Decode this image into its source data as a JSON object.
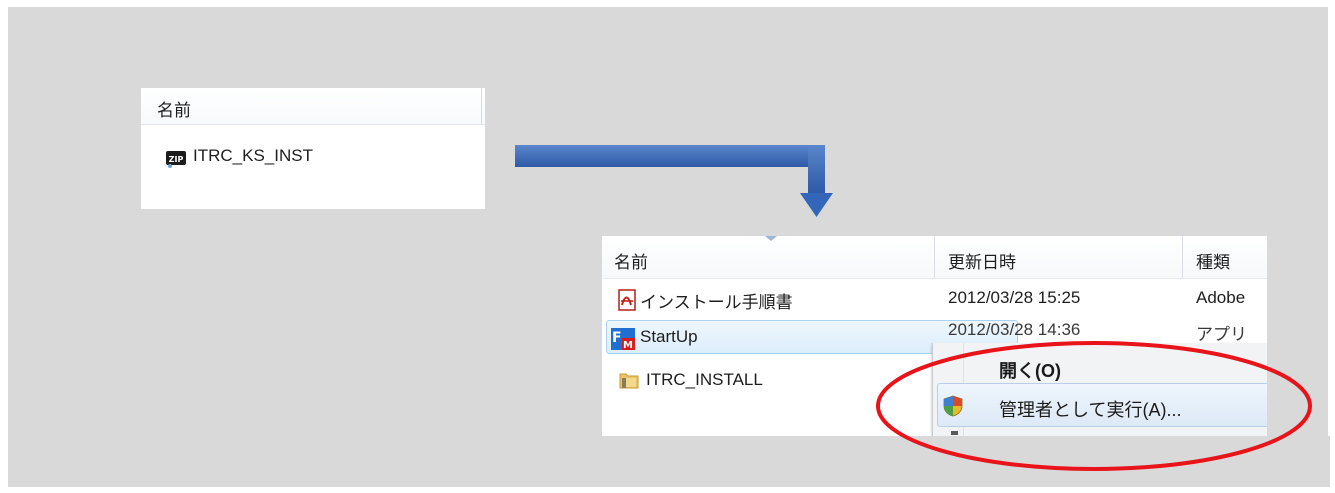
{
  "zip_panel": {
    "column_name": "名前",
    "item": {
      "name": "ITRC_KS_INST",
      "icon": "zip-file-icon"
    }
  },
  "files_panel": {
    "columns": [
      "名前",
      "更新日時",
      "種類"
    ],
    "rows": [
      {
        "name": "インストール手順書",
        "date": "2012/03/28 15:25",
        "type": "Adobe",
        "icon": "pdf-icon"
      },
      {
        "name": "StartUp",
        "date": "2012/03/28 14:36",
        "type": "アプリ",
        "icon": "app-icon"
      },
      {
        "name": "ITRC_INSTALL",
        "date": "",
        "type": "",
        "icon": "folder-icon"
      }
    ]
  },
  "context_menu": {
    "open_label": "開く(O)",
    "run_as_admin_label": "管理者として実行(A)...",
    "shield_icon": "uac-shield-icon"
  },
  "colors": {
    "arrow": "#3a67b1",
    "highlight": "#e8141a",
    "background": "#d9d9d9"
  }
}
